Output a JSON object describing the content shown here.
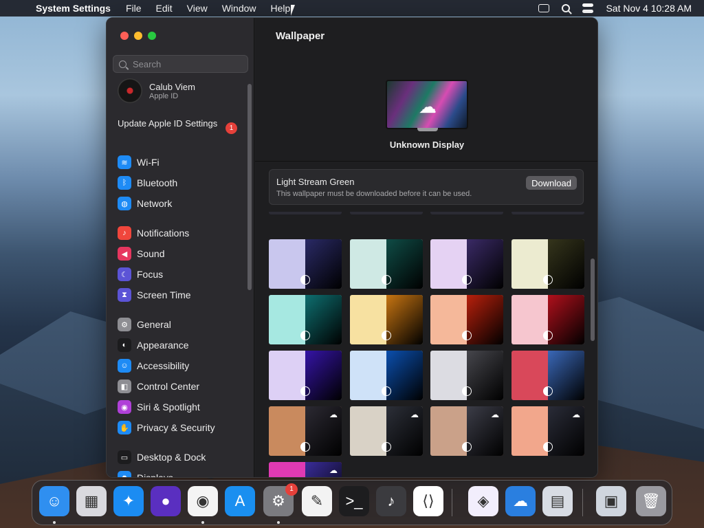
{
  "menubar": {
    "app_name": "System Settings",
    "menus": [
      "File",
      "Edit",
      "View",
      "Window",
      "Help"
    ],
    "clock": "Sat Nov 4  10:28 AM"
  },
  "sidebar": {
    "search_placeholder": "Search",
    "profile": {
      "name": "Calub Viem",
      "subtitle": "Apple ID"
    },
    "update": {
      "label": "Update Apple ID Settings",
      "badge": "1"
    },
    "groups": [
      [
        {
          "label": "Wi-Fi",
          "icon": "wifi-icon",
          "color": "#1e8bf5"
        },
        {
          "label": "Bluetooth",
          "icon": "bluetooth-icon",
          "color": "#1e8bf5"
        },
        {
          "label": "Network",
          "icon": "globe-icon",
          "color": "#1e8bf5"
        }
      ],
      [
        {
          "label": "Notifications",
          "icon": "bell-icon",
          "color": "#f0463c"
        },
        {
          "label": "Sound",
          "icon": "speaker-icon",
          "color": "#e6365f"
        },
        {
          "label": "Focus",
          "icon": "moon-icon",
          "color": "#5c54d6"
        },
        {
          "label": "Screen Time",
          "icon": "hourglass-icon",
          "color": "#5c54d6"
        }
      ],
      [
        {
          "label": "General",
          "icon": "gear-icon",
          "color": "#8e8e93"
        },
        {
          "label": "Appearance",
          "icon": "appearance-icon",
          "color": "#1c1c1e"
        },
        {
          "label": "Accessibility",
          "icon": "accessibility-icon",
          "color": "#1e8bf5"
        },
        {
          "label": "Control Center",
          "icon": "toggles-icon",
          "color": "#8e8e93"
        },
        {
          "label": "Siri & Spotlight",
          "icon": "siri-icon",
          "color": "#b040d8"
        },
        {
          "label": "Privacy & Security",
          "icon": "hand-icon",
          "color": "#1e8bf5"
        }
      ],
      [
        {
          "label": "Desktop & Dock",
          "icon": "dock-icon",
          "color": "#1c1c1e"
        },
        {
          "label": "Displays",
          "icon": "display-icon",
          "color": "#1e8bf5"
        }
      ]
    ]
  },
  "main": {
    "title": "Wallpaper",
    "display_name": "Unknown Display",
    "current": {
      "name": "Light Stream Green",
      "note": "This wallpaper must be downloaded before it can be used.",
      "download_label": "Download"
    },
    "wallpapers": [
      {
        "a": "#c9c7ee",
        "b": "#2a2a66",
        "cloud": false
      },
      {
        "a": "#cfe9e4",
        "b": "#0f4c46",
        "cloud": false
      },
      {
        "a": "#e5d2f3",
        "b": "#3a2a66",
        "cloud": false
      },
      {
        "a": "#ecebd0",
        "b": "#35351c",
        "cloud": false
      },
      {
        "a": "#a6e8e1",
        "b": "#0e6f70",
        "cloud": false
      },
      {
        "a": "#f7e1a1",
        "b": "#c77512",
        "cloud": false
      },
      {
        "a": "#f5b89a",
        "b": "#b8200c",
        "cloud": false
      },
      {
        "a": "#f6c6cf",
        "b": "#b0101c",
        "cloud": false
      },
      {
        "a": "#ddd0f5",
        "b": "#3514a6",
        "cloud": false
      },
      {
        "a": "#cfe2f8",
        "b": "#0b4fae",
        "cloud": false
      },
      {
        "a": "#dcdce2",
        "b": "#46464c",
        "cloud": false
      },
      {
        "a": "#d9485a",
        "b": "#3a68b8",
        "cloud": false
      },
      {
        "a": "#c98a5e",
        "b": "#2c2a33",
        "cloud": true
      },
      {
        "a": "#d9d2c6",
        "b": "#2c2f38",
        "cloud": true
      },
      {
        "a": "#caa189",
        "b": "#3c3d48",
        "cloud": true
      },
      {
        "a": "#f2a78c",
        "b": "#2a2c38",
        "cloud": true
      },
      {
        "a": "#e03ab3",
        "b": "#3a2d9a",
        "cloud": true
      }
    ]
  },
  "dock": {
    "apps": [
      {
        "name": "finder-icon",
        "color": "#2f8ff0",
        "glyph": "☺",
        "dot": true
      },
      {
        "name": "launchpad-icon",
        "color": "#d9d9de",
        "glyph": "▦",
        "dot": false
      },
      {
        "name": "safari-icon",
        "color": "#1b8cf2",
        "glyph": "✦",
        "dot": false
      },
      {
        "name": "firefox-icon",
        "color": "#5a2fc0",
        "glyph": "●",
        "dot": false
      },
      {
        "name": "chrome-icon",
        "color": "#f4f4f4",
        "glyph": "◉",
        "dot": true
      },
      {
        "name": "app-store-icon",
        "color": "#1a8ff0",
        "glyph": "A",
        "dot": false
      },
      {
        "name": "system-settings-icon",
        "color": "#7b7b80",
        "glyph": "⚙",
        "dot": true,
        "badge": "1"
      },
      {
        "name": "textedit-icon",
        "color": "#f3f3f3",
        "glyph": "✎",
        "dot": false
      },
      {
        "name": "terminal-icon",
        "color": "#1d1d1f",
        "glyph": ">_",
        "dot": false
      },
      {
        "name": "garageband-icon",
        "color": "#3b3b3f",
        "glyph": "♪",
        "dot": false
      },
      {
        "name": "vscode-icon",
        "color": "#ffffff",
        "glyph": "⟨⟩",
        "dot": false
      },
      {
        "name": "visual-studio-icon",
        "color": "#f2eefc",
        "glyph": "◈",
        "dot": false
      },
      {
        "name": "weather-icon",
        "color": "#2a7fe0",
        "glyph": "☁",
        "dot": false
      },
      {
        "name": "preview-icon",
        "color": "#d8dce4",
        "glyph": "▤",
        "dot": false
      },
      {
        "name": "downloads-stack-icon",
        "color": "#cfd5de",
        "glyph": "▣",
        "dot": false
      },
      {
        "name": "trash-icon",
        "color": "#9a9aa0",
        "glyph": "🗑",
        "dot": false
      }
    ]
  }
}
